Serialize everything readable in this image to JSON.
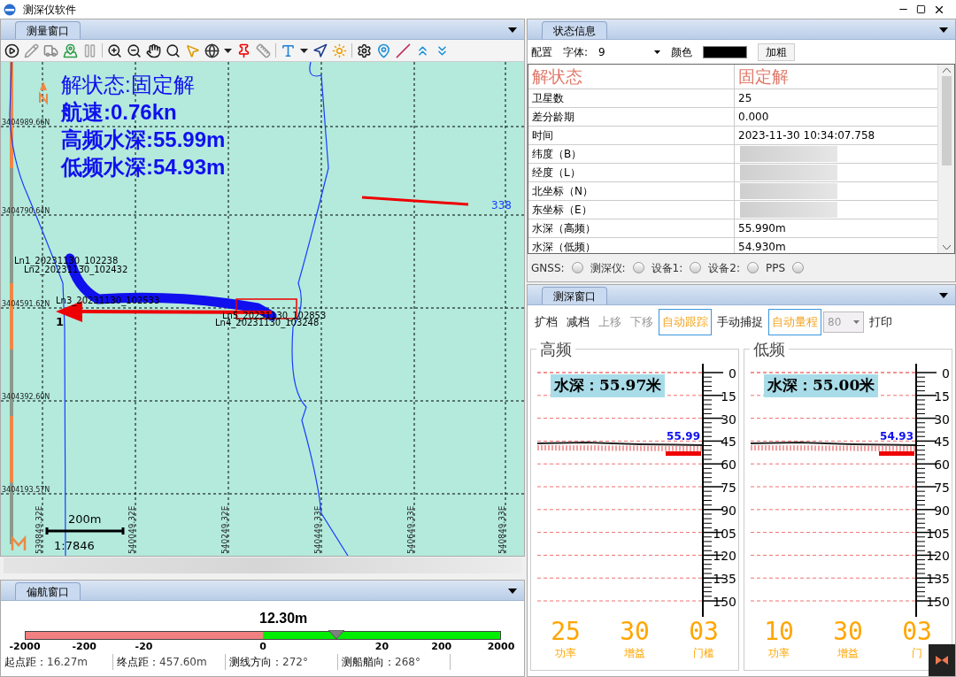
{
  "window": {
    "title": "测深仪软件"
  },
  "map_panel": {
    "tab": "测量窗口",
    "overlay": [
      "解状态:固定解",
      "航速:0.76kn",
      "高频水深:55.99m",
      "低频水深:54.93m"
    ],
    "northings": [
      "3404989.66N",
      "3404790.64N",
      "3404591.62N",
      "3404392.60N",
      "3404193.57N"
    ],
    "eastings": [
      "539849.32E",
      "540049.32E",
      "540249.32E",
      "540449.33E",
      "540649.33E",
      "540849.33E"
    ],
    "tracks": [
      {
        "label": "Ln1_20231130_102238"
      },
      {
        "label": "Ln2_20231130_102432"
      },
      {
        "label": "Ln3_20231130_102533"
      },
      {
        "label": "Ln5_20231130_102853"
      },
      {
        "label": "Ln4_20231130_103248"
      }
    ],
    "point_label": "1",
    "line_label": "338",
    "scale": {
      "distance": "200m",
      "ratio": "1:7846"
    }
  },
  "deviation_panel": {
    "tab": "偏航窗口",
    "offset": "12.30m",
    "level": 0.655,
    "ticks": [
      "-2000",
      "-200",
      "-20",
      "0",
      "20",
      "200",
      "2000"
    ],
    "stats": [
      {
        "label": "起点距：",
        "value": "16.27m"
      },
      {
        "label": "终点距：",
        "value": "457.60m"
      },
      {
        "label": "测线方向：",
        "value": "272°"
      },
      {
        "label": "测船艏向：",
        "value": "268°"
      }
    ]
  },
  "status_panel": {
    "tab": "状态信息",
    "config": {
      "label": "配置",
      "font_label": "字体:",
      "font_value": "9",
      "color_label": "颜色",
      "bold_label": "加粗"
    },
    "rows": [
      {
        "kind": "header",
        "name": "解状态",
        "value": "固定解"
      },
      {
        "kind": "row",
        "name": "卫星数",
        "value": "25"
      },
      {
        "kind": "row",
        "name": "差分龄期",
        "value": "0.000"
      },
      {
        "kind": "row",
        "name": "时间",
        "value": "2023-11-30 10:34:07.758"
      },
      {
        "kind": "blurred",
        "name": "纬度（B）"
      },
      {
        "kind": "blurred",
        "name": "经度（L）"
      },
      {
        "kind": "blurred",
        "name": "北坐标（N）"
      },
      {
        "kind": "blurred",
        "name": "东坐标（E）"
      },
      {
        "kind": "row",
        "name": "水深（高频）",
        "value": "55.990m"
      },
      {
        "kind": "row",
        "name": "水深（低频）",
        "value": "54.930m"
      }
    ],
    "leds": [
      {
        "label": "GNSS:",
        "on": false
      },
      {
        "label": "测深仪:",
        "on": false
      },
      {
        "label": "设备1:",
        "on": false
      },
      {
        "label": "设备2:",
        "on": false
      },
      {
        "label": "PPS",
        "on": false
      }
    ]
  },
  "sounder_panel": {
    "tab": "测深窗口",
    "buttons": [
      {
        "label": "扩档",
        "disabled": false,
        "selected": false
      },
      {
        "label": "减档",
        "disabled": false,
        "selected": false
      },
      {
        "label": "上移",
        "disabled": true,
        "selected": false
      },
      {
        "label": "下移",
        "disabled": true,
        "selected": false
      },
      {
        "label": "自动跟踪",
        "disabled": false,
        "selected": true
      },
      {
        "label": "手动捕捉",
        "disabled": false,
        "selected": false
      },
      {
        "label": "自动量程",
        "disabled": false,
        "selected": true
      }
    ],
    "range": "80",
    "print": "打印",
    "channels": [
      {
        "title": "高频",
        "depth": "水深：55.97米",
        "current": "55.99",
        "scale": [
          "0",
          "15",
          "30",
          "45",
          "60",
          "75",
          "90",
          "105",
          "120",
          "135",
          "150"
        ],
        "readouts": [
          {
            "value": "25",
            "label": "功率"
          },
          {
            "value": "30",
            "label": "增益"
          },
          {
            "value": "03",
            "label": "门槛"
          }
        ]
      },
      {
        "title": "低频",
        "depth": "水深：55.00米",
        "current": "54.93",
        "scale": [
          "0",
          "15",
          "30",
          "45",
          "60",
          "75",
          "90",
          "105",
          "120",
          "135",
          "150"
        ],
        "readouts": [
          {
            "value": "10",
            "label": "功率"
          },
          {
            "value": "30",
            "label": "增益"
          },
          {
            "value": "03",
            "label": "门"
          }
        ]
      }
    ]
  }
}
